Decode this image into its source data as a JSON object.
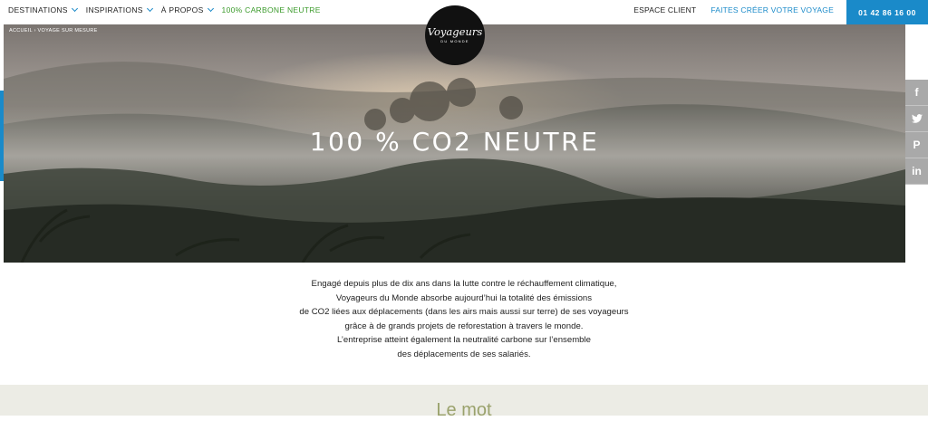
{
  "nav": {
    "left": [
      {
        "label": "DESTINATIONS",
        "dropdown": true
      },
      {
        "label": "INSPIRATIONS",
        "dropdown": true
      },
      {
        "label": "À PROPOS",
        "dropdown": true
      },
      {
        "label": "100% CARBONE NEUTRE",
        "dropdown": false
      }
    ],
    "espace_client": "ESPACE CLIENT",
    "faites_creer": "FAITES CRÉER VOTRE VOYAGE",
    "phone": "01 42 86 16 00"
  },
  "logo": {
    "brand": "Voyageurs",
    "sub": "DU MONDE"
  },
  "hero": {
    "breadcrumb": "ACCUEIL › VOYAGE SUR MESURE",
    "title": "100 % CO2 NEUTRE"
  },
  "social": [
    {
      "icon": "facebook-icon",
      "glyph": "f"
    },
    {
      "icon": "twitter-icon",
      "glyph": "t"
    },
    {
      "icon": "pinterest-icon",
      "glyph": "P"
    },
    {
      "icon": "linkedin-icon",
      "glyph": "in"
    }
  ],
  "intro": {
    "lines": [
      "Engagé depuis plus de dix ans dans la lutte contre le réchauffement climatique,",
      "Voyageurs du Monde absorbe aujourd’hui la totalité des émissions",
      "de CO2 liées aux déplacements (dans les airs mais aussi sur terre) de ses voyageurs",
      "grâce à de grands projets de reforestation à travers le monde.",
      "L’entreprise atteint également la neutralité carbone sur l’ensemble",
      "des déplacements de ses salariés."
    ]
  },
  "section": {
    "title": "Le mot"
  },
  "colors": {
    "accent": "#1a8ac9",
    "green": "#3a9a2a",
    "band": "#ecece5",
    "band_title": "#9aa26c"
  }
}
